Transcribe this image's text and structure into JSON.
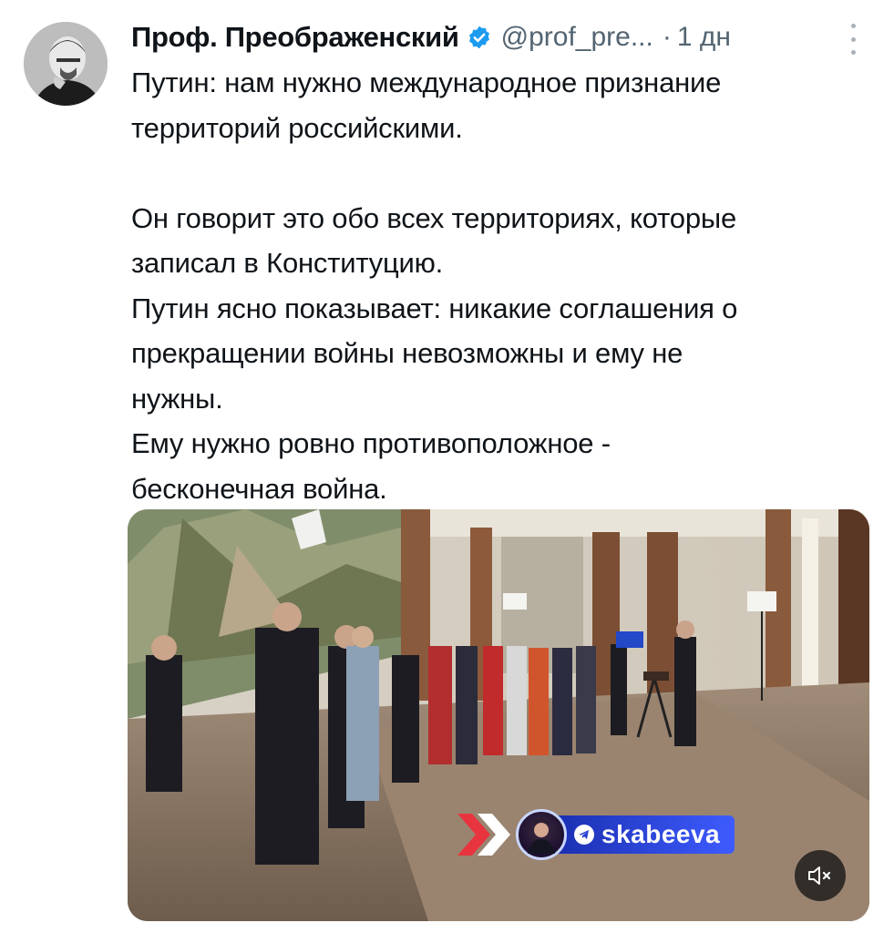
{
  "author": {
    "display_name": "Проф. Преображенский",
    "handle": "@prof_pre...",
    "separator": "·",
    "timestamp": "1 дн",
    "verified": true,
    "avatar_icon": "avatar-portrait"
  },
  "tweet": {
    "paragraphs": [
      [
        "Путин: нам нужно международное признание",
        "территорий российскими."
      ],
      [
        "Он говорит это обо всех территориях, которые",
        "записал в Конституцию."
      ],
      [
        "Путин ясно показывает: никакие соглашения о",
        "прекращении войны невозможны и ему не",
        "нужны."
      ],
      [
        "Ему нужно ровно противоположное -",
        "бесконечная война."
      ]
    ]
  },
  "media": {
    "type": "video",
    "watermark_text": "skabeeva",
    "mute_icon": "volume-muted-icon",
    "colors": {
      "watermark_blue": "#3e5cff",
      "overlay_dark": "#141414"
    }
  },
  "colors": {
    "text_primary": "#0f1419",
    "text_secondary": "#536471",
    "verified_blue": "#1d9bf0"
  }
}
